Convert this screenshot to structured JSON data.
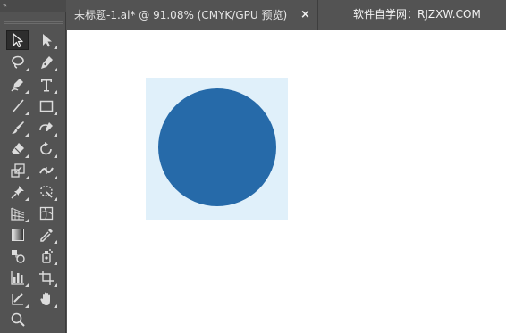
{
  "window": {
    "collapse_glyph": "«"
  },
  "document_tab": {
    "title": "未标题-1.ai* @ 91.08% (CMYK/GPU 预览)",
    "close_glyph": "×"
  },
  "watermark": {
    "text": "软件自学网：RJZXW.COM"
  },
  "toolbar": {
    "tools": [
      {
        "name": "selection-tool",
        "icon": "arrow-icon",
        "selected": true
      },
      {
        "name": "direct-selection-tool",
        "icon": "white-arrow-icon",
        "selected": false
      },
      {
        "name": "lasso-tool",
        "icon": "lasso-icon",
        "selected": false
      },
      {
        "name": "pen-tool",
        "icon": "pen-icon",
        "selected": false
      },
      {
        "name": "curvature-tool",
        "icon": "curvature-pen-icon",
        "selected": false
      },
      {
        "name": "type-tool",
        "icon": "type-t-icon",
        "selected": false
      },
      {
        "name": "line-tool",
        "icon": "line-segment-icon",
        "selected": false
      },
      {
        "name": "rectangle-tool",
        "icon": "rectangle-icon",
        "selected": false
      },
      {
        "name": "paintbrush-tool",
        "icon": "paintbrush-icon",
        "selected": false
      },
      {
        "name": "shaper-tool",
        "icon": "shaper-icon",
        "selected": false
      },
      {
        "name": "eraser-tool",
        "icon": "eraser-icon",
        "selected": false
      },
      {
        "name": "rotate-tool",
        "icon": "rotate-icon",
        "selected": false
      },
      {
        "name": "scale-tool",
        "icon": "scale-icon",
        "selected": false
      },
      {
        "name": "width-tool",
        "icon": "width-icon",
        "selected": false
      },
      {
        "name": "puppet-warp-tool",
        "icon": "pushpin-icon",
        "selected": false
      },
      {
        "name": "free-transform-tool",
        "icon": "free-transform-icon",
        "selected": false
      },
      {
        "name": "perspective-grid-tool",
        "icon": "perspective-grid-icon",
        "selected": false
      },
      {
        "name": "mesh-tool",
        "icon": "mesh-icon",
        "selected": false
      },
      {
        "name": "gradient-tool",
        "icon": "gradient-icon",
        "selected": false
      },
      {
        "name": "eyedropper-tool",
        "icon": "eyedropper-icon",
        "selected": false
      },
      {
        "name": "blend-tool",
        "icon": "blend-icon",
        "selected": false
      },
      {
        "name": "symbol-sprayer-tool",
        "icon": "symbol-sprayer-icon",
        "selected": false
      },
      {
        "name": "column-graph-tool",
        "icon": "bar-graph-icon",
        "selected": false
      },
      {
        "name": "artboard-tool",
        "icon": "artboard-icon",
        "selected": false
      },
      {
        "name": "slice-tool",
        "icon": "slice-icon",
        "selected": false
      },
      {
        "name": "hand-tool",
        "icon": "hand-icon",
        "selected": false
      },
      {
        "name": "zoom-tool",
        "icon": "magnifier-icon",
        "selected": false
      }
    ]
  },
  "artwork": {
    "background_color": "#e0f0fa",
    "circle_color": "#266aa9"
  },
  "colors": {
    "chrome": "#535353",
    "selected_tool": "#2d2d2d",
    "canvas": "#ffffff"
  }
}
